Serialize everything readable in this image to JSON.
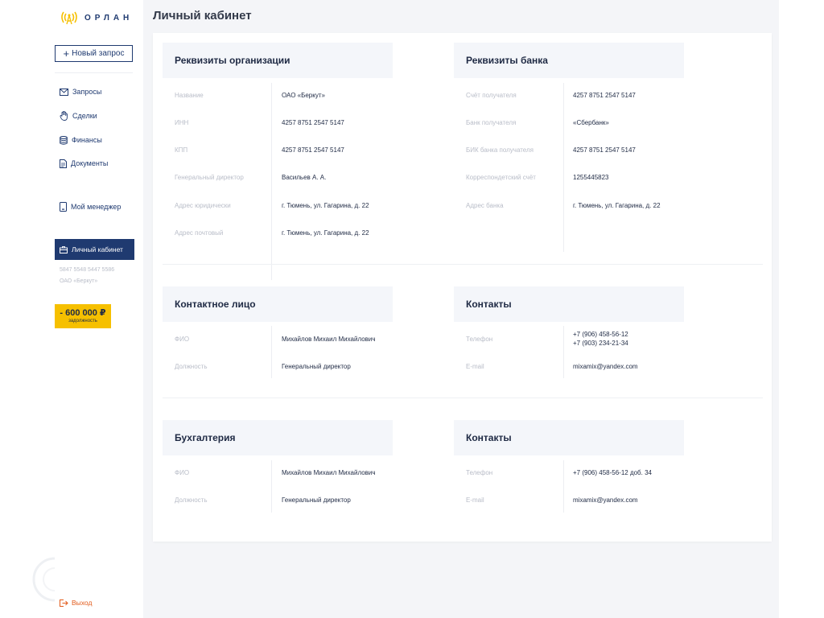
{
  "app": {
    "logo_text": "ОРЛАН"
  },
  "sidebar": {
    "new_request": "Новый запрос",
    "items": [
      {
        "label": "Запросы",
        "icon": "envelope-icon"
      },
      {
        "label": "Сделки",
        "icon": "hand-icon"
      },
      {
        "label": "Финансы",
        "icon": "coins-icon"
      },
      {
        "label": "Документы",
        "icon": "document-icon"
      },
      {
        "label": "Мой менеджер",
        "icon": "phone-icon"
      }
    ],
    "cabinet": "Личный кабинет",
    "account_number": "5847 5548 5447 5586",
    "account_org": "ОАО «Беркут»",
    "debt_amount": "- 600 000 ₽",
    "debt_label": "задолжность",
    "logout": "Выход"
  },
  "page": {
    "title": "Личный кабинет"
  },
  "org": {
    "title": "Реквизиты организации",
    "rows": [
      {
        "label": "Название",
        "value": "ОАО «Беркут»"
      },
      {
        "label": "ИНН",
        "value": "4257 8751 2547 5147"
      },
      {
        "label": "КПП",
        "value": "4257 8751 2547 5147"
      },
      {
        "label": "Генеральный директор",
        "value": "Васильев А. А."
      },
      {
        "label": "Адрес юридически",
        "value": "г. Тюмень, ул. Гагарина, д. 22"
      },
      {
        "label": "Адрес почтовый",
        "value": "г. Тюмень, ул. Гагарина, д. 22"
      }
    ]
  },
  "bank": {
    "title": "Реквизиты банка",
    "rows": [
      {
        "label": "Счёт получателя",
        "value": "4257 8751 2547 5147"
      },
      {
        "label": "Банк получателя",
        "value": "«Сбербанк»"
      },
      {
        "label": "БИК банка получателя",
        "value": "4257 8751 2547 5147"
      },
      {
        "label": "Корреспондетский счёт",
        "value": "1255445823"
      },
      {
        "label": "Адрес банка",
        "value": "г. Тюмень, ул. Гагарина, д. 22"
      }
    ]
  },
  "contact_person": {
    "title": "Контактное лицо",
    "rows": [
      {
        "label": "ФИО",
        "value": "Михайлов Михаил Михайлович"
      },
      {
        "label": "Должность",
        "value": "Генеральный директор"
      }
    ]
  },
  "contacts1": {
    "title": "Контакты",
    "phone_label": "Телефон",
    "phone_1": "+7 (906) 458-56-12",
    "phone_2": "+7 (903) 234-21-34",
    "email_label": "E-mail",
    "email": "mixamix@yandex.com"
  },
  "accounting": {
    "title": "Бухгалтерия",
    "rows": [
      {
        "label": "ФИО",
        "value": "Михайлов Михаил Михайлович"
      },
      {
        "label": "Должность",
        "value": "Генеральный директор"
      }
    ]
  },
  "contacts2": {
    "title": "Контакты",
    "rows": [
      {
        "label": "Телефон",
        "value": "+7 (906) 458-56-12 доб. 34"
      },
      {
        "label": "E-mail",
        "value": "mixamix@yandex.com"
      }
    ]
  },
  "colors": {
    "brand": "#1f3a70",
    "accent": "#f6c000",
    "logout": "#e25b1b"
  }
}
